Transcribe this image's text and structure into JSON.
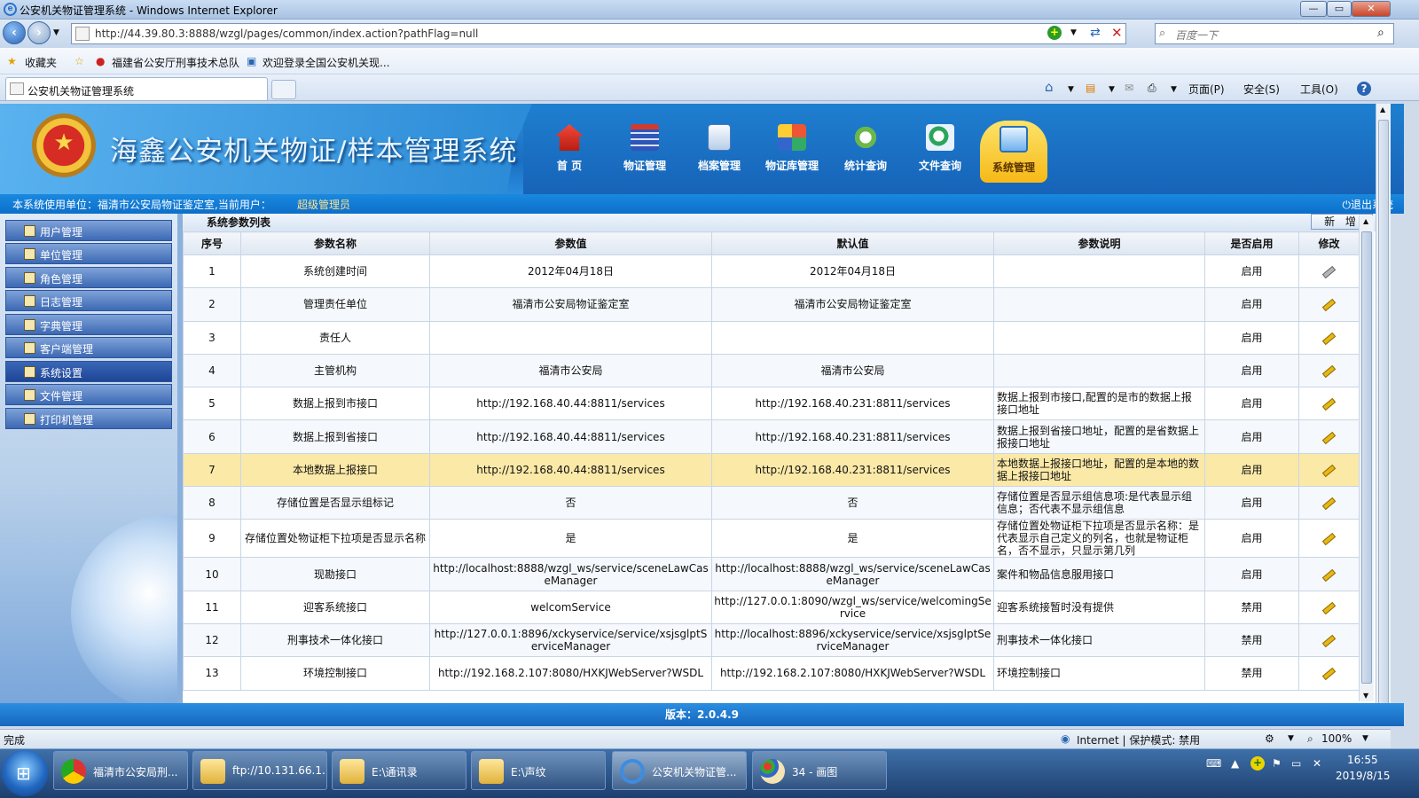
{
  "browser": {
    "window_title": "公安机关物证管理系统 - Windows Internet Explorer",
    "url": "http://44.39.80.3:8888/wzgl/pages/common/index.action?pathFlag=null",
    "search_placeholder": "百度一下",
    "favorites_label": "收藏夹",
    "favorites": [
      "福建省公安厅刑事技术总队",
      "欢迎登录全国公安机关现..."
    ],
    "tab_title": "公安机关物证管理系统",
    "toolbar": {
      "page": "页面(P)",
      "safety": "安全(S)",
      "tools": "工具(O)"
    },
    "window_controls": {
      "minimize": "—",
      "maximize": "▭",
      "close": "✕"
    }
  },
  "app": {
    "title": "海鑫公安机关物证/样本管理系统",
    "nav": [
      {
        "label": "首  页",
        "icon": "home-icon"
      },
      {
        "label": "物证管理",
        "icon": "calendar-icon"
      },
      {
        "label": "档案管理",
        "icon": "document-icon"
      },
      {
        "label": "物证库管理",
        "icon": "grid-icon"
      },
      {
        "label": "统计查询",
        "icon": "chart-search-icon"
      },
      {
        "label": "文件查询",
        "icon": "file-search-icon"
      },
      {
        "label": "系统管理",
        "icon": "monitor-icon",
        "active": true
      }
    ],
    "user_bar": {
      "unit_text": "本系统使用单位：福清市公安局物证鉴定室,当前用户：",
      "user_name": "超级管理员",
      "logout": "退出系统"
    },
    "sidebar": [
      {
        "label": "用户管理"
      },
      {
        "label": "单位管理"
      },
      {
        "label": "角色管理"
      },
      {
        "label": "日志管理"
      },
      {
        "label": "字典管理"
      },
      {
        "label": "客户端管理"
      },
      {
        "label": "系统设置",
        "active": true
      },
      {
        "label": "文件管理"
      },
      {
        "label": "打印机管理"
      }
    ],
    "list_caption": "系统参数列表",
    "add_button": "新 增",
    "table": {
      "headers": [
        "序号",
        "参数名称",
        "参数值",
        "默认值",
        "参数说明",
        "是否启用",
        "修改"
      ],
      "rows": [
        [
          "1",
          "系统创建时间",
          "2012年04月18日",
          "2012年04月18日",
          "",
          "启用"
        ],
        [
          "2",
          "管理责任单位",
          "福清市公安局物证鉴定室",
          "福清市公安局物证鉴定室",
          "",
          "启用"
        ],
        [
          "3",
          "责任人",
          "",
          "",
          "",
          "启用"
        ],
        [
          "4",
          "主管机构",
          "福清市公安局",
          "福清市公安局",
          "",
          "启用"
        ],
        [
          "5",
          "数据上报到市接口",
          "http://192.168.40.44:8811/services",
          "http://192.168.40.231:8811/services",
          "数据上报到市接口,配置的是市的数据上报接口地址",
          "启用"
        ],
        [
          "6",
          "数据上报到省接口",
          "http://192.168.40.44:8811/services",
          "http://192.168.40.231:8811/services",
          "数据上报到省接口地址，配置的是省数据上报接口地址",
          "启用"
        ],
        [
          "7",
          "本地数据上报接口",
          "http://192.168.40.44:8811/services",
          "http://192.168.40.231:8811/services",
          "本地数据上报接口地址，配置的是本地的数据上报接口地址",
          "启用"
        ],
        [
          "8",
          "存储位置是否显示组标记",
          "否",
          "否",
          "存储位置是否显示组信息项:是代表显示组信息；否代表不显示组信息",
          "启用"
        ],
        [
          "9",
          "存储位置处物证柜下拉项是否显示名称",
          "是",
          "是",
          "存储位置处物证柜下拉项是否显示名称：是代表显示自己定义的列名，也就是物证柜名，否不显示，只显示第几列",
          "启用"
        ],
        [
          "10",
          "现勘接口",
          "http://localhost:8888/wzgl_ws/service/sceneLawCaseManager",
          "http://localhost:8888/wzgl_ws/service/sceneLawCaseManager",
          "案件和物品信息服用接口",
          "启用"
        ],
        [
          "11",
          "迎客系统接口",
          "welcomService",
          "http://127.0.0.1:8090/wzgl_ws/service/welcomingService",
          "迎客系统接暂时没有提供",
          "禁用"
        ],
        [
          "12",
          "刑事技术一体化接口",
          "http://127.0.0.1:8896/xckyservice/service/xsjsglptServiceManager",
          "http://localhost:8896/xckyservice/service/xsjsglptServiceManager",
          "刑事技术一体化接口",
          "禁用"
        ],
        [
          "13",
          "环境控制接口",
          "http://192.168.2.107:8080/HXKJWebServer?WSDL",
          "http://192.168.2.107:8080/HXKJWebServer?WSDL",
          "环境控制接口",
          "禁用"
        ]
      ],
      "highlighted_row": 7
    },
    "footer": "版本：2.0.4.9"
  },
  "status_bar": {
    "left": "完成",
    "zone": "Internet | 保护模式: 禁用",
    "zoom": "100%"
  },
  "taskbar": {
    "items": [
      {
        "label": "福清市公安局刑...",
        "icon": "chrome-icon"
      },
      {
        "label": "ftp://10.131.66.1...",
        "icon": "folder-icon"
      },
      {
        "label": "E:\\通讯录",
        "icon": "folder-icon"
      },
      {
        "label": "E:\\声纹",
        "icon": "folder-icon"
      },
      {
        "label": "公安机关物证管...",
        "icon": "ie-icon",
        "active": true
      },
      {
        "label": "34 - 画图",
        "icon": "paint-icon"
      }
    ],
    "time": "16:55",
    "date": "2019/8/15"
  }
}
